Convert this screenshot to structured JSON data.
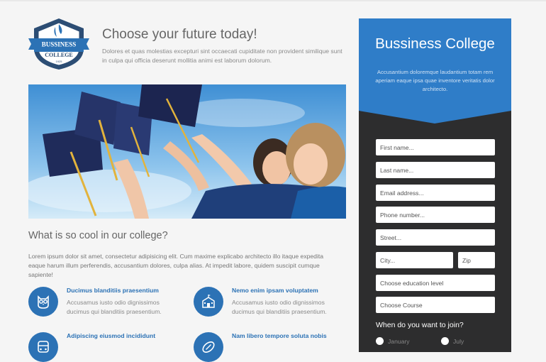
{
  "header": {
    "logo": {
      "line1": "BUSSINESS",
      "line2": "COLLEGE",
      "year": "1925"
    },
    "headline": "Choose your future today!",
    "intro": "Dolores et quas molestias excepturi sint occaecati cupiditate non provident similique sunt in culpa qui officia deserunt mollitia animi est laborum dolorum."
  },
  "main": {
    "section_title": "What is so cool in our college?",
    "section_text": "Lorem ipsum dolor sit amet, consectetur adipisicing elit. Cum maxime explicabo architecto illo itaque expedita eaque harum illum perferendis, accusantium dolores, culpa alias. At impedit labore, quidem suscipit cumque sapiente!",
    "features": [
      {
        "title": "Ducimus blanditiis praesentium",
        "text": "Accusamus iusto odio dignissimos ducimus qui blanditiis praesentium.",
        "icon": "owl-icon"
      },
      {
        "title": "Nemo enim ipsam voluptatem",
        "text": "Accusamus iusto odio dignissimos ducimus qui blanditiis praesentium.",
        "icon": "school-building-icon"
      },
      {
        "title": "Adipiscing eiusmod incididunt",
        "text": "",
        "icon": "bus-icon"
      },
      {
        "title": "Nam libero tempore soluta nobis",
        "text": "",
        "icon": "football-icon"
      }
    ]
  },
  "form": {
    "college_name": "Bussiness College",
    "college_desc": "Accusantium doloremque laudantium totam rem aperiam eaque ipsa quae inventore veritatis dolor architecto.",
    "first_name_placeholder": "First name...",
    "last_name_placeholder": "Last name...",
    "email_placeholder": "Email address...",
    "phone_placeholder": "Phone number...",
    "street_placeholder": "Street...",
    "city_placeholder": "City...",
    "zip_placeholder": "Zip",
    "education_level": "Choose education level",
    "course": "Choose Course",
    "join_label": "When do you want to join?",
    "months": [
      "January",
      "July"
    ]
  },
  "colors": {
    "accent": "#2c72b5",
    "panel": "#2d2d2e",
    "background": "#f5f5f5"
  }
}
